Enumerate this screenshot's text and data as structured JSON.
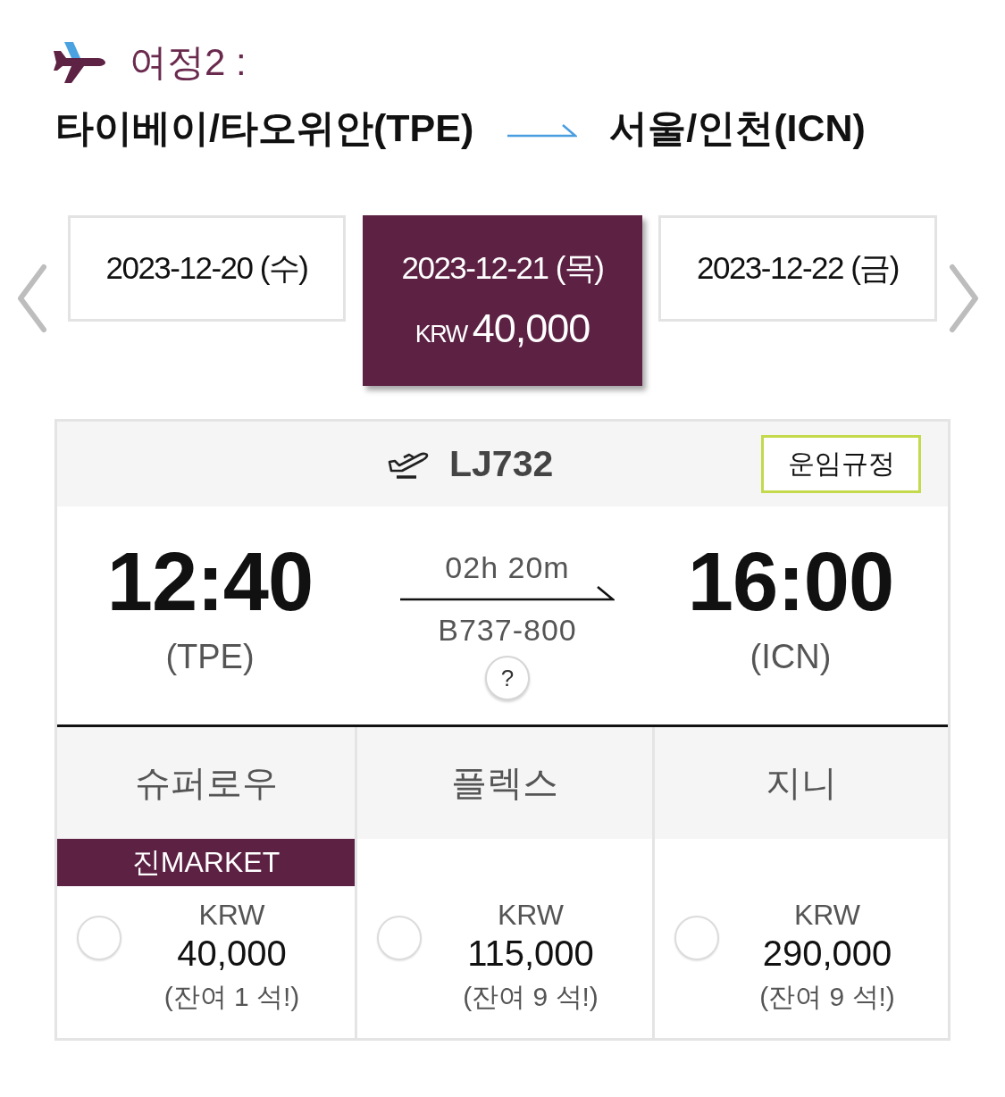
{
  "itinerary": {
    "label": "여정2 :",
    "origin": "타이베이/타오위안(TPE)",
    "destination": "서울/인천(ICN)"
  },
  "date_tabs": [
    {
      "date": "2023-12-20 (수)",
      "selected": false
    },
    {
      "date": "2023-12-21 (목)",
      "selected": true,
      "currency": "KRW",
      "price": "40,000"
    },
    {
      "date": "2023-12-22 (금)",
      "selected": false
    }
  ],
  "flight": {
    "number": "LJ732",
    "fare_rules_button": "운임규정",
    "departure": {
      "time": "12:40",
      "airport": "(TPE)"
    },
    "duration": "02h 20m",
    "aircraft": "B737-800",
    "help_button": "?",
    "arrival": {
      "time": "16:00",
      "airport": "(ICN)"
    }
  },
  "fares": [
    {
      "name": "슈퍼로우",
      "tag": "진MARKET",
      "currency": "KRW",
      "price": "40,000",
      "seats": "(잔여 1 석!)",
      "selected": false
    },
    {
      "name": "플렉스",
      "currency": "KRW",
      "price": "115,000",
      "seats": "(잔여 9 석!)",
      "selected": false
    },
    {
      "name": "지니",
      "currency": "KRW",
      "price": "290,000",
      "seats": "(잔여 9 석!)",
      "selected": false
    }
  ]
}
